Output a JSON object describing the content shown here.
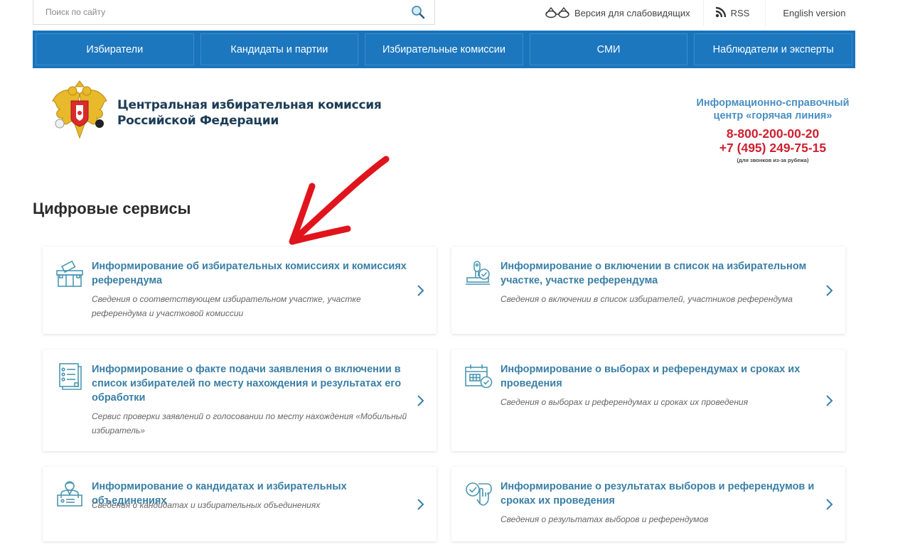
{
  "search": {
    "placeholder": "Поиск по сайту",
    "value": ""
  },
  "top_links": {
    "visually_impaired": "Версия для слабовидящих",
    "rss": "RSS",
    "english": "English version"
  },
  "nav": {
    "items": [
      {
        "label": "Избиратели"
      },
      {
        "label": "Кандидаты и партии"
      },
      {
        "label": "Избирательные комиссии"
      },
      {
        "label": "СМИ"
      },
      {
        "label": "Наблюдатели и эксперты"
      }
    ]
  },
  "header": {
    "org_name_line1": "Центральная избирательная комиссия",
    "org_name_line2": "Российской Федерации",
    "hotline": {
      "title_line1": "Информационно-справочный",
      "title_line2": "центр «горячая линия»",
      "phone1": "8-800-200-00-20",
      "phone2": "+7 (495) 249-75-15",
      "note": "(для звонков из-за рубежа)"
    }
  },
  "colors": {
    "nav_blue": "#1a74bb",
    "card_title": "#3a7fa6",
    "hotline_red": "#cf2030",
    "annotation_red": "#e0141c"
  },
  "section": {
    "title": "Цифровые сервисы",
    "cards": [
      {
        "icon": "ballot-box-icon",
        "title": "Информирование об избирательных комиссиях и комиссиях референдума",
        "description": "Сведения о соответствующем избирательном участке, участке референдума и участковой комиссии"
      },
      {
        "icon": "stamp-check-icon",
        "title": "Информирование о включении в список на избирательном участке, участке референдума",
        "description": "Сведения о включении в список избирателей, участников референдума"
      },
      {
        "icon": "document-list-icon",
        "title": "Информирование о факте подачи заявления о включении в список избирателей по месту нахождения и результатах его обработки",
        "description": "Сервис проверки заявлений о голосовании по месту нахождения «Мобильный избиратель»"
      },
      {
        "icon": "calendar-check-icon",
        "title": "Информирование о выборах и референдумах и сроках их проведения",
        "description": "Сведения о выборах и референдумах и сроках их проведения"
      },
      {
        "icon": "candidate-icon",
        "title": "Информирование о кандидатах и избирательных объединениях",
        "description": "Сведения о кандидатах и избирательных объединениях"
      },
      {
        "icon": "check-hand-icon",
        "title": "Информирование о результатах выборов и референдумов и сроках их проведения",
        "description": "Сведения о результатах выборов и референдумов"
      }
    ]
  }
}
